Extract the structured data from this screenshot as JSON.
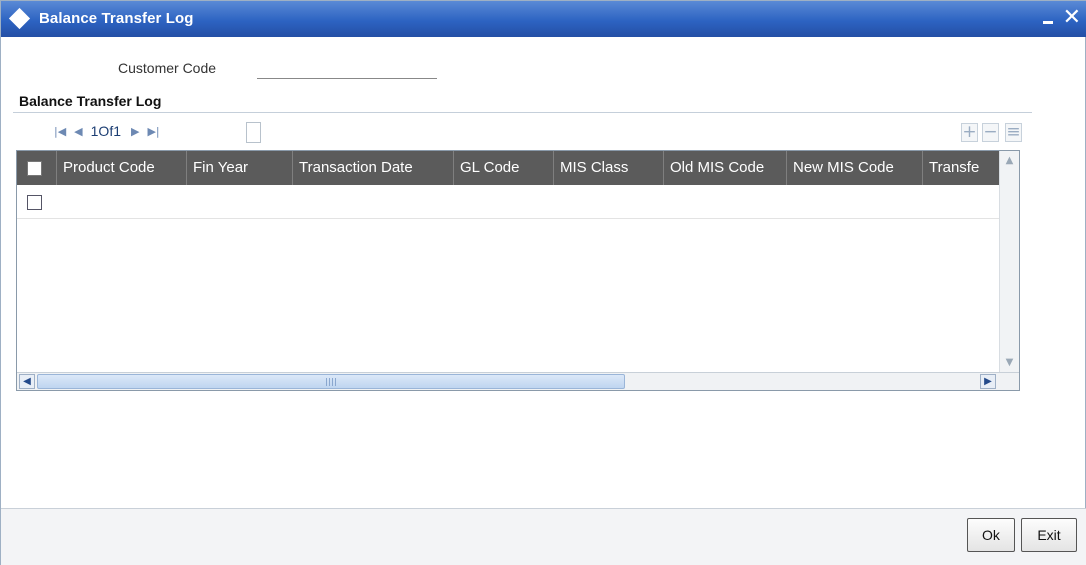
{
  "window": {
    "title": "Balance Transfer Log",
    "minimize_icon": "minimize-icon",
    "close_icon": "close-icon",
    "close_glyph": "✕"
  },
  "form": {
    "customer_code_label": "Customer Code",
    "customer_code_value": ""
  },
  "section": {
    "title": "Balance Transfer Log"
  },
  "pager": {
    "first_glyph": "|◀",
    "prev_glyph": "◀",
    "text": "1Of1",
    "next_glyph": "▶",
    "last_glyph": "▶|"
  },
  "toolbar": {
    "add_glyph": "+",
    "delete_glyph": "−",
    "list_glyph": "≡"
  },
  "grid": {
    "columns": [
      "Product Code",
      "Fin Year",
      "Transaction Date",
      "GL Code",
      "MIS Class",
      "Old MIS Code",
      "New MIS Code",
      "Transfe"
    ],
    "rows": [
      [
        "",
        "",
        "",
        "",
        "",
        "",
        "",
        ""
      ]
    ]
  },
  "scroll": {
    "up_glyph": "▲",
    "down_glyph": "▼",
    "left_glyph": "◀",
    "right_glyph": "▶"
  },
  "buttons": {
    "ok": "Ok",
    "exit": "Exit"
  },
  "colors": {
    "titlebar": "#2d63c2",
    "grid_header": "#5b5b5b"
  }
}
